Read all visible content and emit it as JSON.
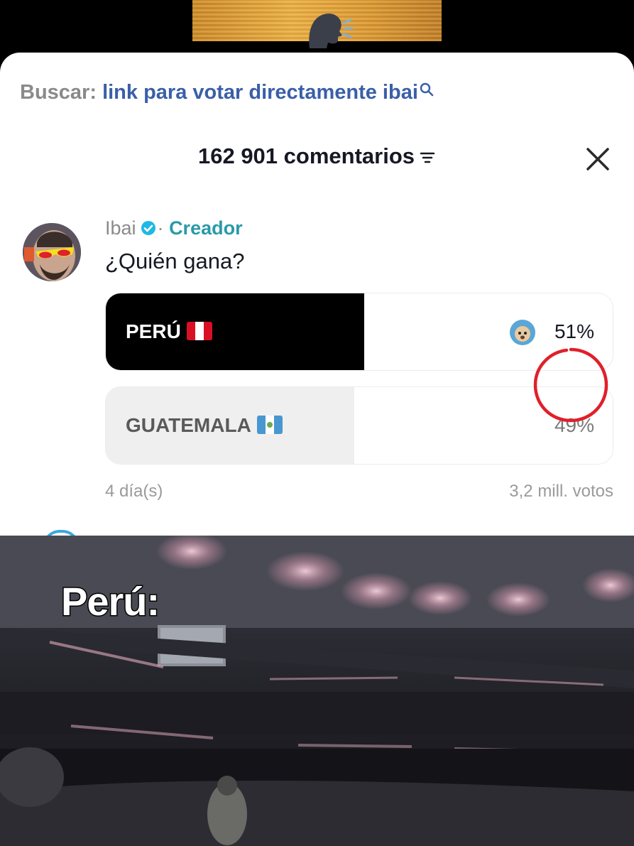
{
  "search": {
    "prefix": "Buscar:",
    "query": "link para votar directamente ibai",
    "icon": "search-icon"
  },
  "header": {
    "comment_count": "162 901 comentarios",
    "filter_icon": "filter-icon",
    "close_icon": "close-icon"
  },
  "comment": {
    "author": "Ibai",
    "verified": true,
    "separator": "·",
    "role": "Creador",
    "text": "¿Quién gana?",
    "age": "4 día(s)"
  },
  "poll": {
    "options": [
      {
        "label": "PERÚ",
        "flag": "flag-peru",
        "percent_text": "51%",
        "percent": 51,
        "voted": true
      },
      {
        "label": "GUATEMALA",
        "flag": "flag-guatemala",
        "percent_text": "49%",
        "percent": 49,
        "voted": false
      }
    ],
    "votes": "3,2 mill. votos"
  },
  "video": {
    "caption": "Perú:"
  },
  "colors": {
    "accent_link": "#3a5fa8",
    "creator": "#2a9aa8",
    "verified": "#20b8e6",
    "highlight_ring": "#e0202a",
    "selected_fill": "#000000",
    "unselected_fill": "#efefef"
  }
}
